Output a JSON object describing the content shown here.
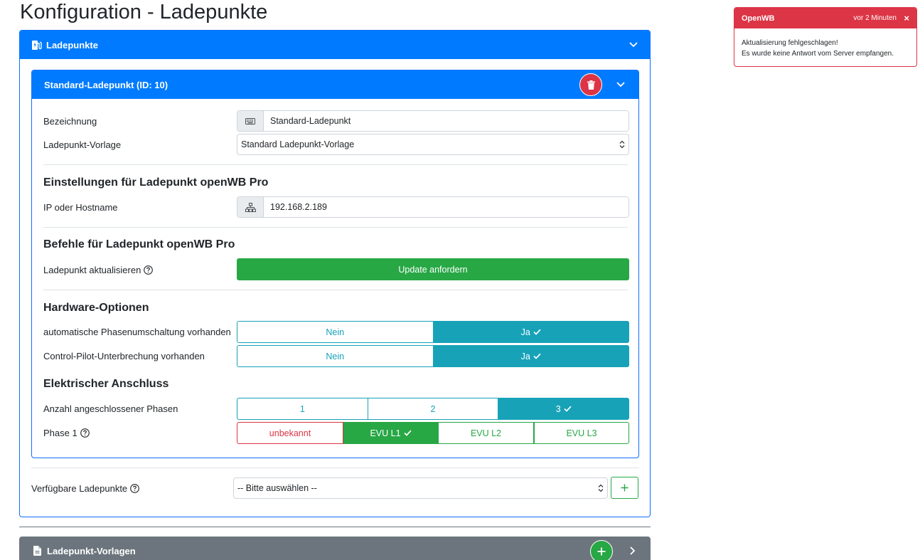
{
  "page": {
    "title": "Konfiguration - Ladepunkte"
  },
  "main_card": {
    "title": "Ladepunkte"
  },
  "inner_card": {
    "title": "Standard-Ladepunkt (ID: 10)"
  },
  "fields": {
    "bezeichnung_label": "Bezeichnung",
    "bezeichnung_value": "Standard-Ladepunkt",
    "vorlage_label": "Ladepunkt-Vorlage",
    "vorlage_value": "Standard Ladepunkt-Vorlage"
  },
  "settings": {
    "title": "Einstellungen für Ladepunkt openWB Pro",
    "ip_label": "IP oder Hostname",
    "ip_value": "192.168.2.189"
  },
  "commands": {
    "title": "Befehle für Ladepunkt openWB Pro",
    "update_label": "Ladepunkt aktualisieren",
    "update_button": "Update anfordern"
  },
  "hardware": {
    "title": "Hardware-Optionen",
    "phase_switch_label": "automatische Phasenumschaltung vorhanden",
    "cp_interrupt_label": "Control-Pilot-Unterbrechung vorhanden",
    "options": [
      "Nein",
      "Ja"
    ],
    "phase_switch_selected": "Ja",
    "cp_interrupt_selected": "Ja"
  },
  "electrical": {
    "title": "Elektrischer Anschluss",
    "phases_label": "Anzahl angeschlossener Phasen",
    "phases_options": [
      "1",
      "2",
      "3"
    ],
    "phases_selected": "3",
    "phase1_label": "Phase 1",
    "phase1_options": [
      "unbekannt",
      "EVU L1",
      "EVU L2",
      "EVU L3"
    ],
    "phase1_selected": "EVU L1"
  },
  "available": {
    "label": "Verfügbare Ladepunkte",
    "placeholder": "-- Bitte auswählen --"
  },
  "templates_card": {
    "title": "Ladepunkt-Vorlagen"
  },
  "toast": {
    "title": "OpenWB",
    "time": "vor 2 Minuten",
    "close": "×",
    "line1": "Aktualisierung fehlgeschlagen!",
    "line2": "Es wurde keine Antwort vom Server empfangen."
  },
  "colors": {
    "primary": "#007bff",
    "success": "#28a745",
    "info": "#17a2b8",
    "danger": "#dc3545",
    "secondary": "#6c757d"
  },
  "icons": {
    "main_card": "charging-station-icon",
    "bezeichnung": "keyboard-icon",
    "ip": "network-icon",
    "templates": "file-icon"
  }
}
